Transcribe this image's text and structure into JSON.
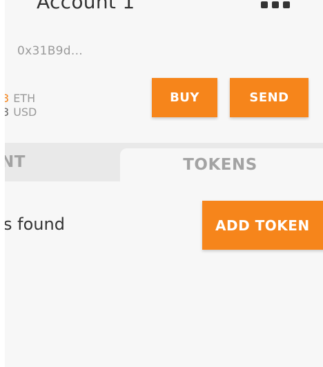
{
  "account": {
    "name": "Account 1",
    "address": "0x31B9d..."
  },
  "balance": {
    "eth_value": "3",
    "eth_unit": "ETH",
    "usd_value": "3",
    "usd_unit": "USD"
  },
  "actions": {
    "buy_label": "BUY",
    "send_label": "SEND"
  },
  "tabs": [
    {
      "label": "NT"
    },
    {
      "label": "TOKENS"
    }
  ],
  "tokens": {
    "empty_message": "s found",
    "add_token_label": "ADD TOKEN"
  },
  "colors": {
    "accent": "#f6851b",
    "background": "#f7f7f7",
    "tab_bar": "#e9e9e9",
    "text_dark": "#333333",
    "text_muted": "#9a9a9a"
  },
  "icons": {
    "account_menu": "more-menu-icon"
  }
}
